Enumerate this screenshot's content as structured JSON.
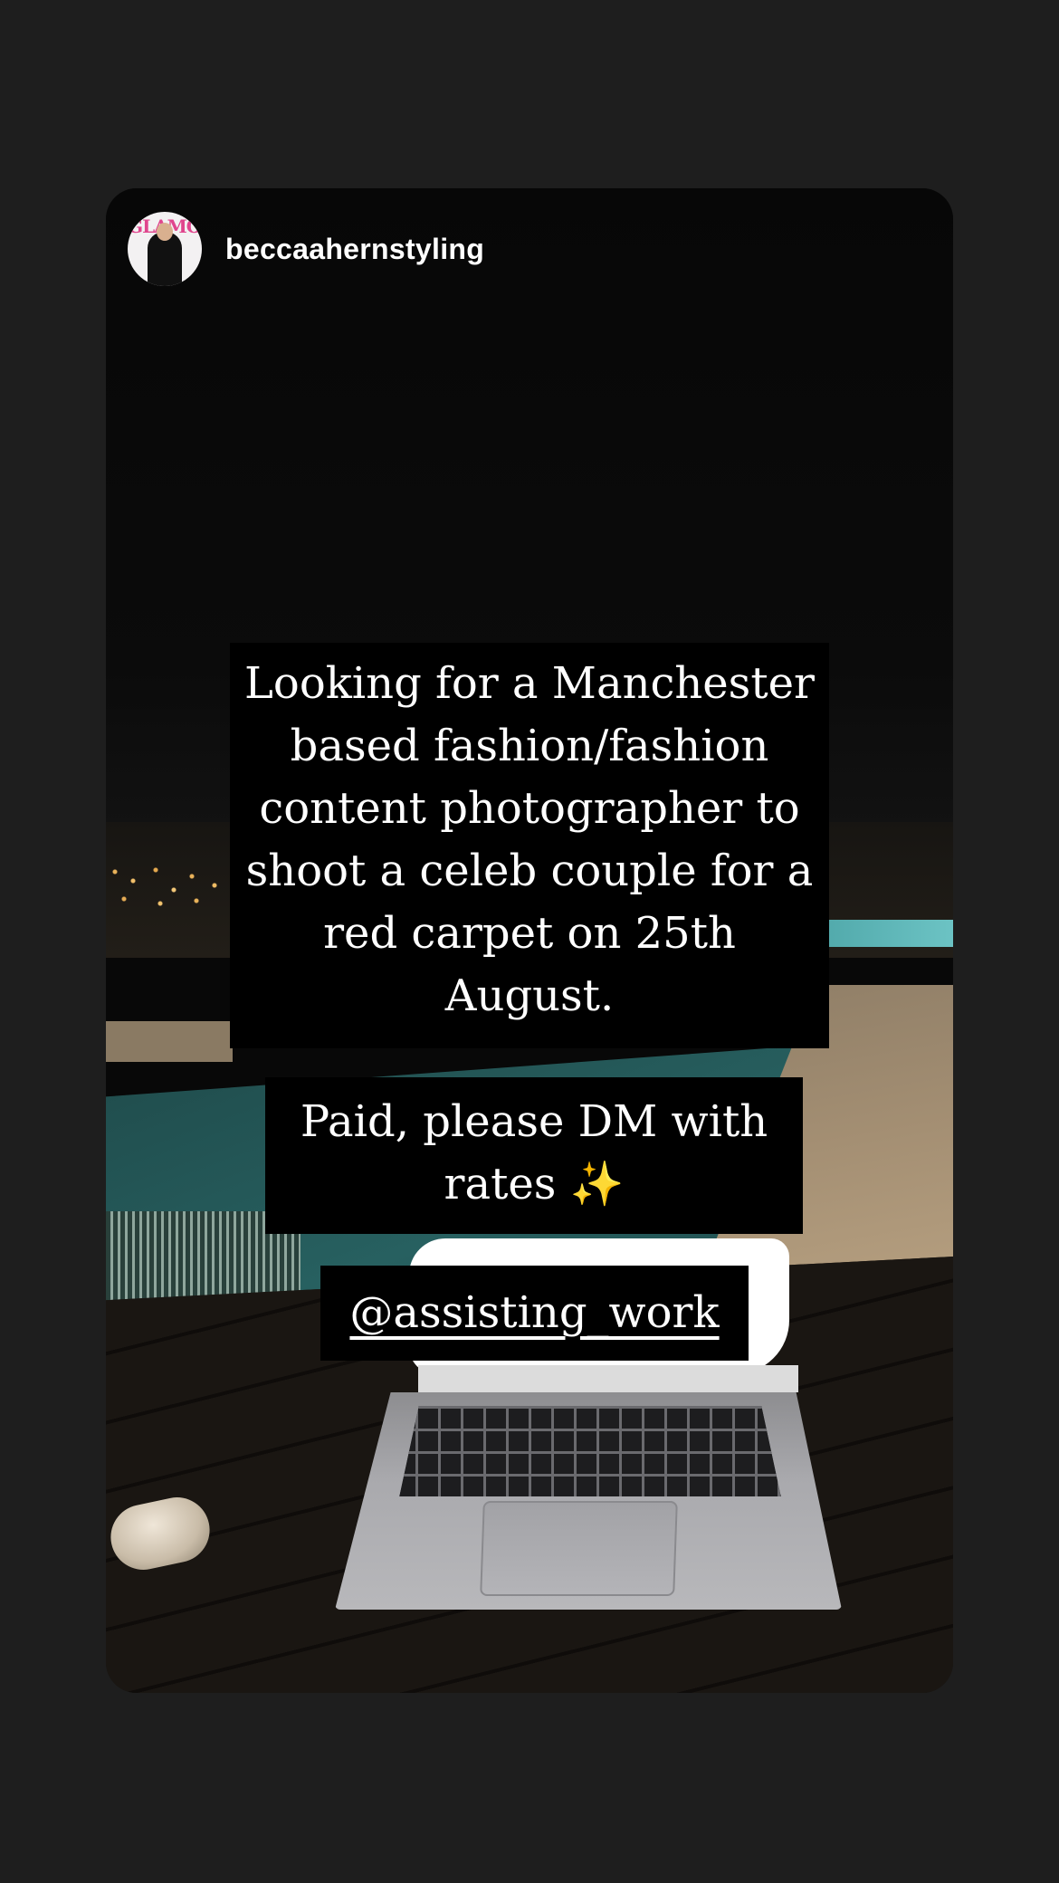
{
  "story": {
    "username": "beccaahernstyling",
    "avatar_logo_text": "GLAMOUR",
    "caption_main": "Looking for a Manchester based fashion/fashion content photographer to shoot a celeb couple for a red carpet on 25th August.",
    "caption_paid": "Paid, please DM with rates",
    "caption_paid_emoji": "✨",
    "mention": "@assisting_work"
  },
  "colors": {
    "page_background": "#1e1e1e",
    "caption_background": "#000000",
    "caption_text": "#ffffff"
  }
}
